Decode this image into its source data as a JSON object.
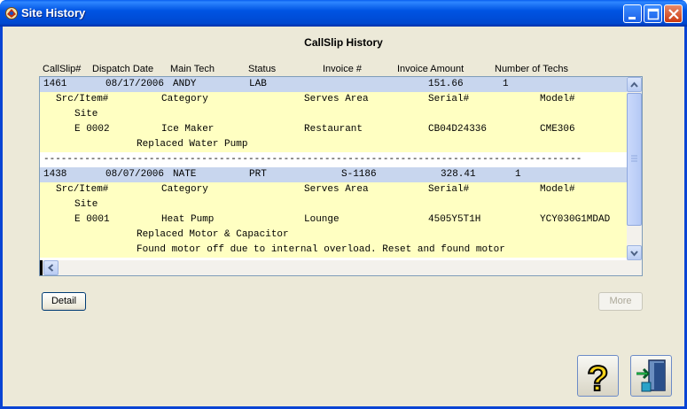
{
  "window": {
    "title": "Site History"
  },
  "heading": "CallSlip History",
  "columns": [
    "CallSlip#",
    "Dispatch Date",
    "Main Tech",
    "Status",
    "Invoice #",
    "Invoice Amount",
    "Number of Techs"
  ],
  "slips": [
    {
      "callslip": "1461",
      "date": "08/17/2006",
      "tech": "ANDY",
      "status": "LAB",
      "invoice": "",
      "amount": "151.66",
      "num_techs": "1",
      "detail_header": {
        "src_item": "Src/Item#",
        "category": "Category",
        "serves": "Serves Area",
        "serial": "Serial#",
        "model": "Model#"
      },
      "site_label": "Site",
      "item": {
        "src": "E 0002",
        "category": "Ice Maker",
        "serves": "Restaurant",
        "serial": "CB04D24336",
        "model": "CME306"
      },
      "notes": [
        "Replaced Water Pump"
      ]
    },
    {
      "callslip": "1438",
      "date": "08/07/2006",
      "tech": "NATE",
      "status": "PRT",
      "invoice": "S-1186",
      "amount": "328.41",
      "num_techs": "1",
      "detail_header": {
        "src_item": "Src/Item#",
        "category": "Category",
        "serves": "Serves Area",
        "serial": "Serial#",
        "model": "Model#"
      },
      "site_label": "Site",
      "item": {
        "src": "E 0001",
        "category": "Heat Pump",
        "serves": "Lounge",
        "serial": "4505Y5T1H",
        "model": "YCY030G1MDAD"
      },
      "notes": [
        "Replaced Motor & Capacitor",
        "Found motor off due to internal overload. Reset and found motor"
      ]
    }
  ],
  "separator": "--------------------------------------------------------------------------------------------",
  "buttons": {
    "detail": "Detail",
    "more": "More"
  },
  "icons": {
    "help": "help-question-icon",
    "exit": "exit-door-icon"
  }
}
